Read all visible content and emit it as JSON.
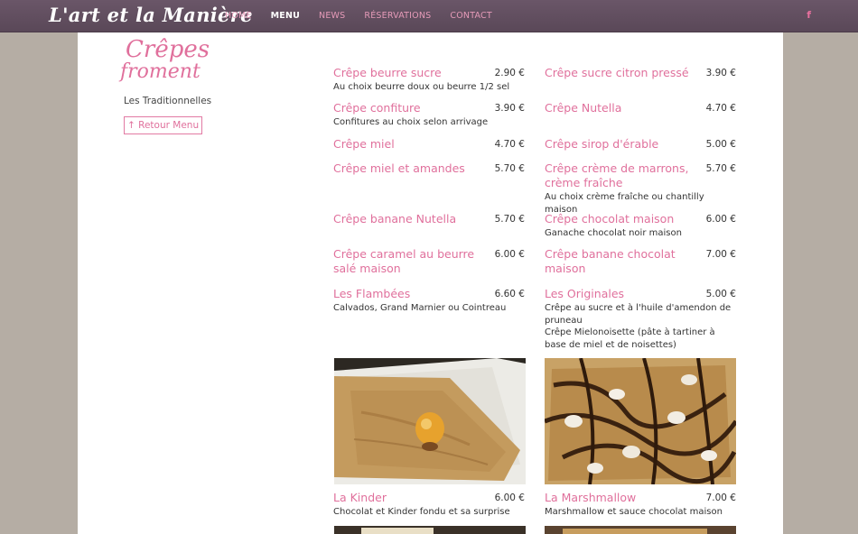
{
  "header": {
    "logo": "L'art et la Manière",
    "nav": [
      "HOME",
      "MENU",
      "NEWS",
      "RÉSERVATIONS",
      "CONTACT"
    ],
    "active_nav": "MENU",
    "social_icon": "f"
  },
  "sidebar": {
    "title_line1": "Crêpes",
    "title_line2": "froment",
    "subtitle": "Les Traditionnelles",
    "back_label": "↑ Retour Menu"
  },
  "menu": {
    "items": [
      {
        "name": "Crêpe beurre sucre",
        "price": "2.90 €",
        "desc": "Au choix beurre doux ou beurre 1/2 sel"
      },
      {
        "name": "Crêpe sucre citron pressé",
        "price": "3.90 €",
        "desc": ""
      },
      {
        "name": "Crêpe confiture",
        "price": "3.90 €",
        "desc": "Confitures au choix selon arrivage"
      },
      {
        "name": "Crêpe Nutella",
        "price": "4.70 €",
        "desc": ""
      },
      {
        "name": "Crêpe miel",
        "price": "4.70 €",
        "desc": ""
      },
      {
        "name": "Crêpe sirop d'érable",
        "price": "5.00 €",
        "desc": ""
      },
      {
        "name": "Crêpe miel et amandes",
        "price": "5.70 €",
        "desc": ""
      },
      {
        "name": "Crêpe crème de marrons, crème fraîche",
        "price": "5.70 €",
        "desc": "Au choix crème fraîche ou chantilly maison"
      },
      {
        "name": "Crêpe banane Nutella",
        "price": "5.70 €",
        "desc": ""
      },
      {
        "name": "Crêpe chocolat maison",
        "price": "6.00 €",
        "desc": "Ganache chocolat noir maison"
      },
      {
        "name": "Crêpe caramel au beurre salé maison",
        "price": "6.00 €",
        "desc": ""
      },
      {
        "name": "Crêpe banane chocolat maison",
        "price": "7.00 €",
        "desc": ""
      },
      {
        "name": "Les Flambées",
        "price": "6.60 €",
        "desc": "Calvados, Grand Marnier ou Cointreau"
      },
      {
        "name": "Les Originales",
        "price": "5.00 €",
        "desc": "Crêpe au sucre et à l'huile d'amendon de pruneau\nCrêpe Mielonoisette (pâte à tartiner à base de miel et de noisettes)"
      },
      {
        "name": "La Kinder",
        "price": "6.00 €",
        "desc": "Chocolat et Kinder fondu et sa surprise"
      },
      {
        "name": "La Marshmallow",
        "price": "7.00 €",
        "desc": "Marshmallow et sauce chocolat maison"
      }
    ]
  },
  "colors": {
    "accent_pink": "#e0709c",
    "topbar": "#5e4b5c",
    "background": "#b5ada4"
  }
}
